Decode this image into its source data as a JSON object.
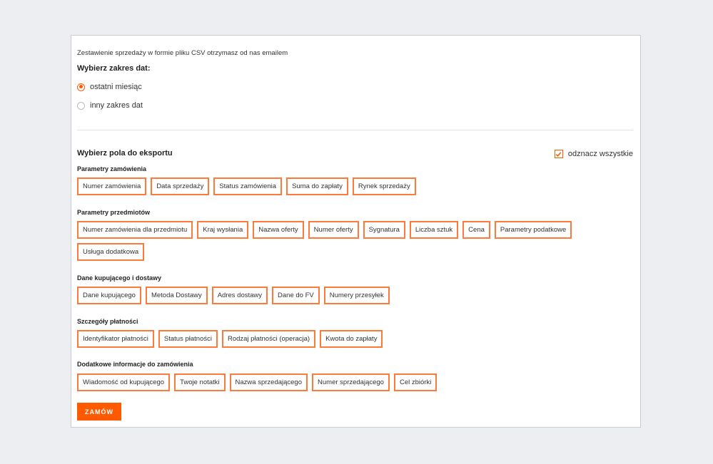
{
  "intro_text": "Zestawienie sprzedaży w formie pliku CSV otrzymasz od nas emailem",
  "date_range": {
    "title": "Wybierz zakres dat:",
    "options": [
      {
        "label": "ostatni miesiąc",
        "checked": true
      },
      {
        "label": "inny zakres dat",
        "checked": false
      }
    ]
  },
  "export_fields": {
    "title": "Wybierz pola do eksportu",
    "deselect_all_label": "odznacz wszystkie",
    "groups": [
      {
        "title": "Parametry zamówienia",
        "fields": [
          "Numer zamówienia",
          "Data sprzedaży",
          "Status zamówienia",
          "Suma do zapłaty",
          "Rynek sprzedaży"
        ]
      },
      {
        "title": "Parametry przedmiotów",
        "fields": [
          "Numer zamówienia dla przedmiotu",
          "Kraj wysłania",
          "Nazwa oferty",
          "Numer oferty",
          "Sygnatura",
          "Liczba sztuk",
          "Cena",
          "Parametry podatkowe",
          "Usługa dodatkowa"
        ]
      },
      {
        "title": "Dane kupującego i dostawy",
        "fields": [
          "Dane kupującego",
          "Metoda Dostawy",
          "Adres dostawy",
          "Dane do FV",
          "Numery przesyłek"
        ]
      },
      {
        "title": "Szczegóły płatności",
        "fields": [
          "Identyfikator płatności",
          "Status płatności",
          "Rodzaj płatności (operacja)",
          "Kwota do zapłaty"
        ]
      },
      {
        "title": "Dodatkowe informacje do zamówienia",
        "fields": [
          "Wiadomość od kupującego",
          "Twoje notatki",
          "Nazwa sprzedającego",
          "Numer sprzedającego",
          "Cel zbiórki"
        ]
      }
    ]
  },
  "submit_label": "ZAMÓW",
  "colors": {
    "accent": "#ff5a00",
    "chip_border": "#ff7a3a",
    "background": "#eceef1"
  }
}
